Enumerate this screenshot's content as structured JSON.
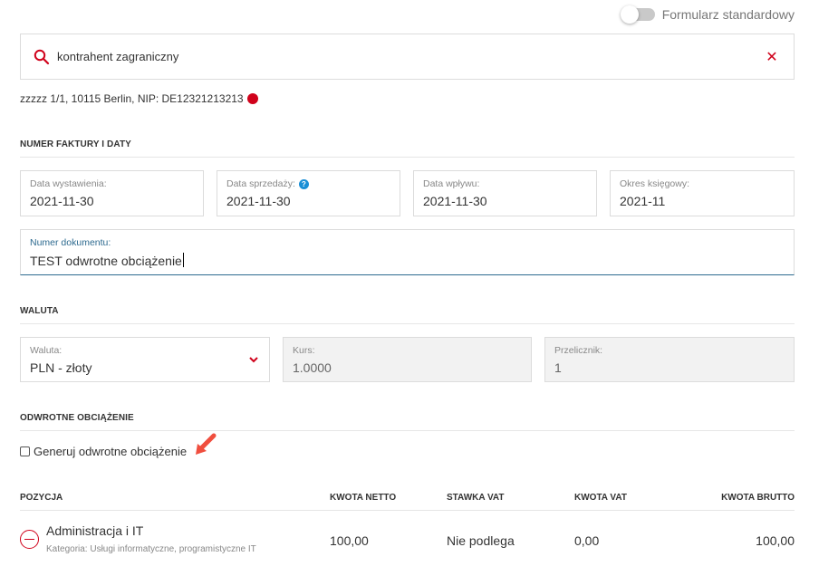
{
  "toggle": {
    "label": "Formularz standardowy",
    "on": false
  },
  "search": {
    "value": "kontrahent zagraniczny"
  },
  "contractor": {
    "address": "zzzzz 1/1, 10115 Berlin, NIP: DE12321213213"
  },
  "sections": {
    "invoice": "NUMER FAKTURY I DATY",
    "currency": "WALUTA",
    "reverse_charge": "ODWROTNE OBCIĄŻENIE"
  },
  "dates": {
    "issue_label": "Data wystawienia:",
    "issue_value": "2021-11-30",
    "sale_label": "Data sprzedaży:",
    "sale_value": "2021-11-30",
    "receipt_label": "Data wpływu:",
    "receipt_value": "2021-11-30",
    "period_label": "Okres księgowy:",
    "period_value": "2021-11"
  },
  "document": {
    "label": "Numer dokumentu:",
    "value": "TEST odwrotne obciążenie"
  },
  "currency": {
    "currency_label": "Waluta:",
    "currency_value": "PLN - złoty",
    "rate_label": "Kurs:",
    "rate_value": "1.0000",
    "converter_label": "Przelicznik:",
    "converter_value": "1"
  },
  "reverse_charge": {
    "checkbox_label": "Generuj odwrotne obciążenie",
    "checked": false
  },
  "table": {
    "headers": [
      "POZYCJA",
      "KWOTA NETTO",
      "STAWKA VAT",
      "KWOTA VAT",
      "KWOTA BRUTTO"
    ],
    "rows": [
      {
        "name": "Administracja i IT",
        "category": "Kategoria: Usługi informatyczne, programistyczne IT",
        "net": "100,00",
        "vat_rate": "Nie podlega",
        "vat": "0,00",
        "gross": "100,00"
      }
    ]
  },
  "colors": {
    "accent_red": "#d0021b",
    "active_blue": "#2d6a8f",
    "help_blue": "#1a8fd6"
  }
}
